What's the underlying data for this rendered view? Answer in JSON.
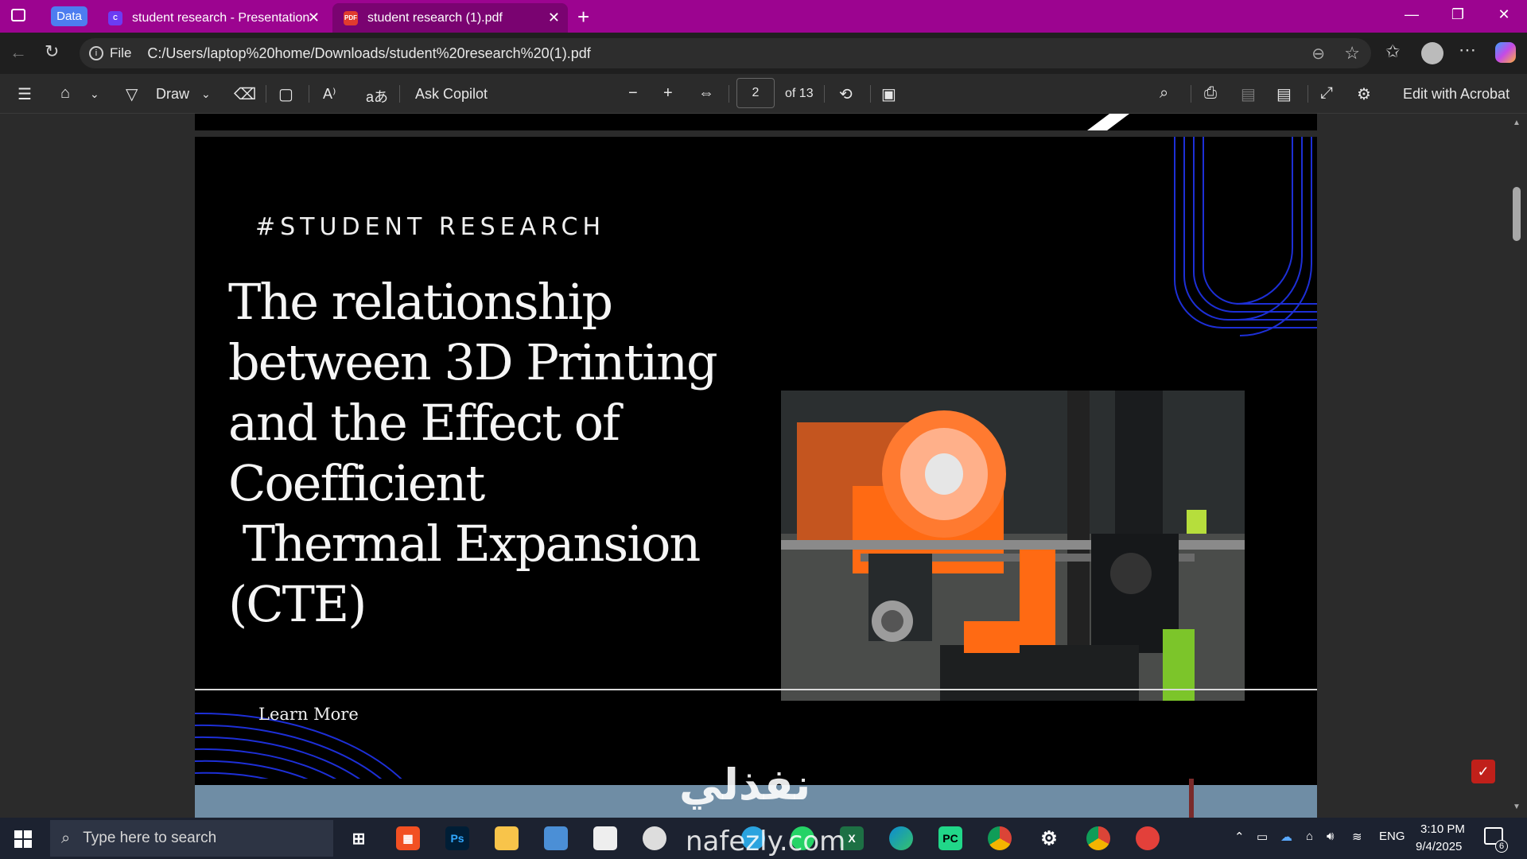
{
  "browser": {
    "workspace_badge": "Data",
    "tabs": [
      {
        "label": "student research - Presentation",
        "icon": "canva-icon",
        "active": false
      },
      {
        "label": "student research (1).pdf",
        "icon": "pdf-icon",
        "active": true
      }
    ],
    "url_prefix": "File",
    "url": "C:/Users/laptop%20home/Downloads/student%20research%20(1).pdf"
  },
  "pdf_toolbar": {
    "draw_label": "Draw",
    "copilot_label": "Ask Copilot",
    "page_current": "2",
    "page_total": "of 13",
    "acrobat_label": "Edit with Acrobat"
  },
  "slide": {
    "kicker": "#STUDENT RESEARCH",
    "headline_lines": [
      "The relationship",
      "between 3D Printing",
      "and the Effect of",
      "Coefficient",
      " Thermal Expansion",
      "(CTE)"
    ],
    "photo_description_icon": "3d-printer-photo",
    "learn_more": "Learn More"
  },
  "watermark": {
    "arabic": "نفذلي",
    "latin": "nafezly.com"
  },
  "taskbar": {
    "search_placeholder": "Type here to search",
    "language": "ENG",
    "time": "3:10 PM",
    "date": "9/4/2025",
    "notification_count": "6"
  },
  "colors": {
    "titlebar": "#9c0490",
    "accent_blue": "#1d2fd6",
    "printer_orange": "#ff6a13"
  }
}
